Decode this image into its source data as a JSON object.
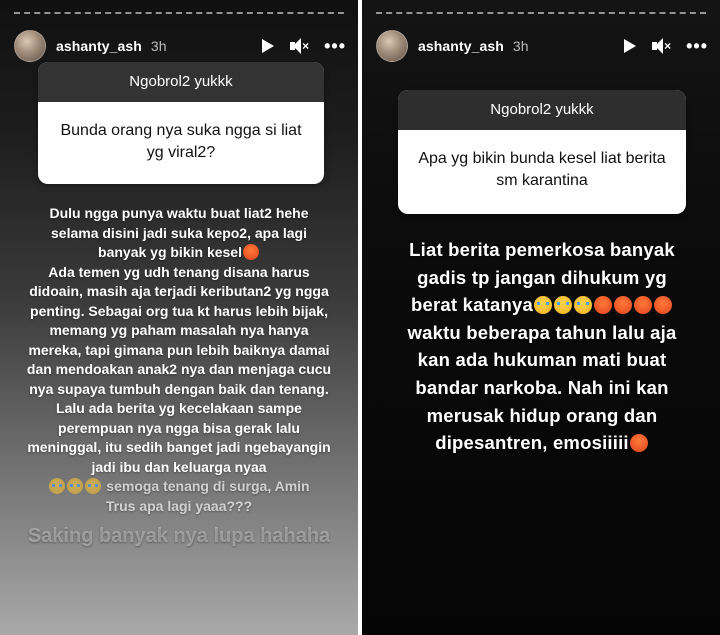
{
  "stories": {
    "left": {
      "username": "ashanty_ash",
      "time": "3h",
      "question_header": "Ngobrol2 yukkk",
      "question": "Bunda orang nya suka ngga si liat yg viral2?",
      "answer": {
        "p1": "Dulu ngga punya waktu buat liat2 hehe selama disini jadi suka kepo2, apa lagi banyak yg bikin kesel",
        "p2": "Ada temen yg udh tenang disana harus didoain, masih aja terjadi keributan2 yg ngga penting. Sebagai org tua kt harus lebih bijak, memang yg paham masalah nya hanya mereka, tapi gimana pun lebih baiknya damai dan mendoakan anak2 nya dan menjaga cucu nya supaya tumbuh dengan baik dan tenang.",
        "p3": "Lalu ada berita yg kecelakaan sampe perempuan nya ngga bisa gerak lalu meninggal, itu sedih banget jadi ngebayangin jadi ibu dan keluarga nyaa",
        "p4": "semoga tenang di surga, Amin",
        "p5": "Trus apa lagi yaaa???",
        "p6": "Saking banyak nya lupa hahaha"
      }
    },
    "right": {
      "username": "ashanty_ash",
      "time": "3h",
      "question_header": "Ngobrol2 yukkk",
      "question": "Apa yg bikin bunda kesel liat berita sm karantina",
      "answer": {
        "p1": "Liat berita pemerkosa banyak gadis tp jangan dihukum yg berat katanya",
        "p2": "waktu beberapa tahun lalu aja kan ada hukuman mati buat bandar narkoba. Nah ini kan merusak hidup orang dan dipesantren, emosiiiii"
      }
    }
  },
  "icons": {
    "play": "play-icon",
    "mute": "mute-icon",
    "more": "more-icon",
    "emoji_sob": "loudly-crying-face",
    "emoji_angry": "angry-face"
  },
  "colors": {
    "question_header_bg": "#333333",
    "question_box_bg": "#ffffff",
    "right_story_bg": "#0b0b0b"
  }
}
